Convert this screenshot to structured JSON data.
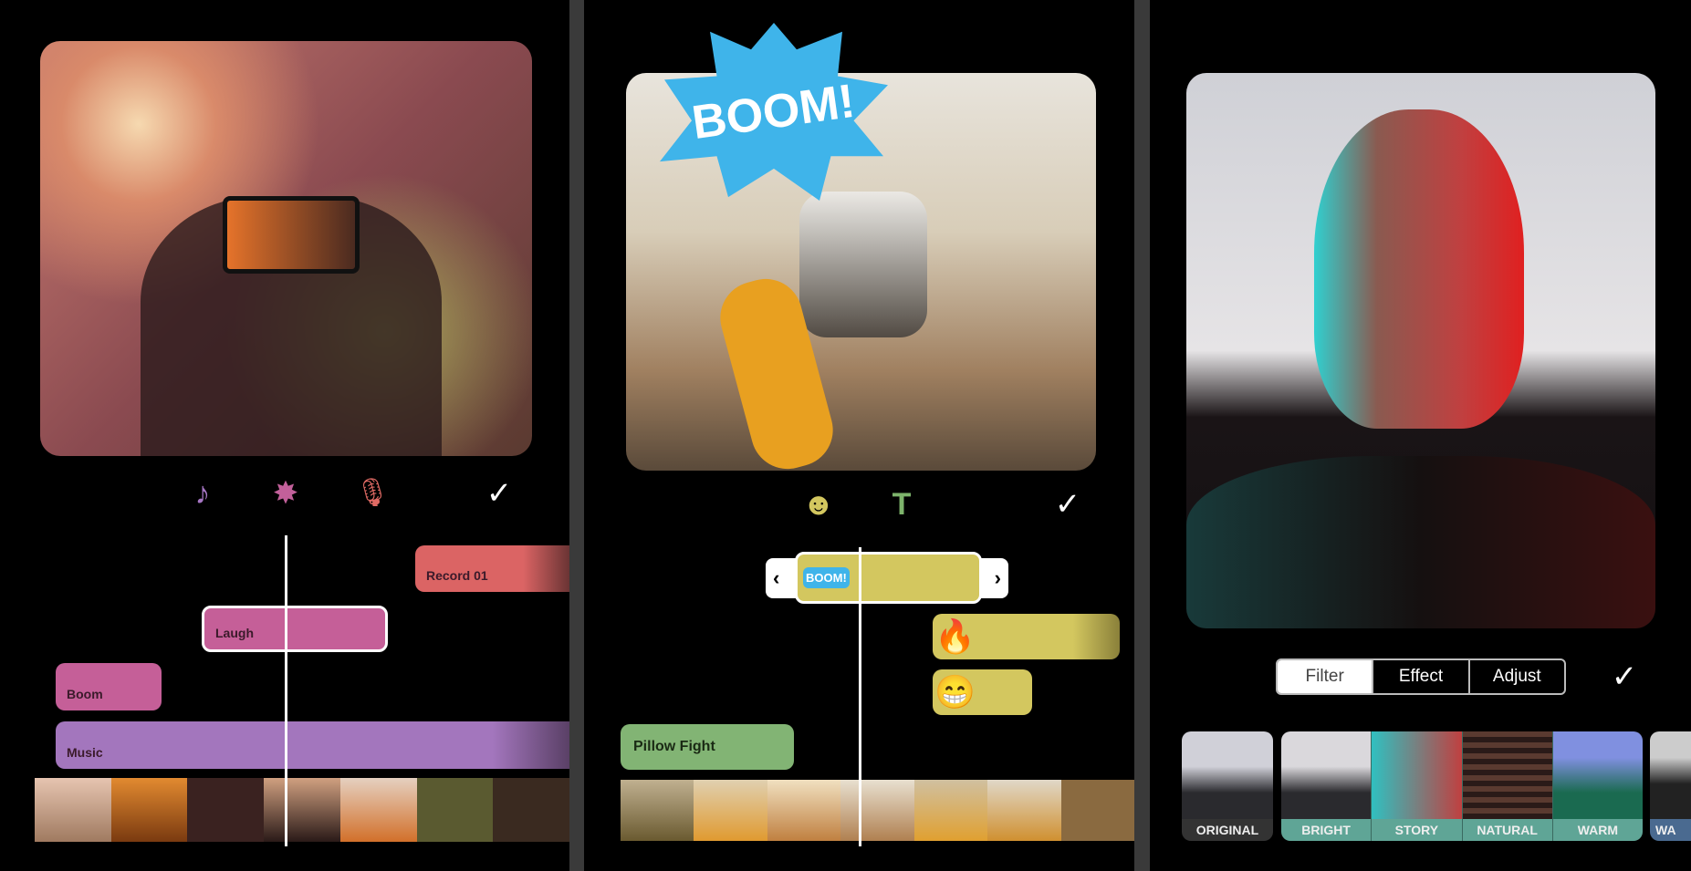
{
  "panel_music": {
    "toolbar": {
      "icons": [
        "music-add-icon",
        "sound-effect-icon",
        "microphone-icon",
        "checkmark-icon"
      ],
      "colors": {
        "music": "#a676c4",
        "effect": "#c2609a",
        "mic": "#e06a64"
      }
    },
    "clips": [
      {
        "label": "Record 01",
        "color": "#db6464"
      },
      {
        "label": "Laugh",
        "color": "#c55f98"
      },
      {
        "label": "Boom",
        "color": "#c55f98"
      },
      {
        "label": "Music",
        "color": "#a376bd"
      }
    ]
  },
  "panel_sticker": {
    "sticker_text": "BOOM!",
    "toolbar": {
      "icons": [
        "sticker-icon",
        "text-icon",
        "checkmark-icon"
      ],
      "colors": {
        "sticker": "#d3c75f",
        "text": "#7db36b"
      }
    },
    "clips": [
      {
        "label": "BOOM!",
        "color": "#d3c75f"
      },
      {
        "label": "🔥",
        "color": "#d3c75f"
      },
      {
        "label": "😁",
        "color": "#d3c75f"
      },
      {
        "label": "Pillow Fight",
        "color": "#82b474"
      }
    ],
    "handle_left": "‹",
    "handle_right": "›"
  },
  "panel_filter": {
    "tabs": [
      "Filter",
      "Effect",
      "Adjust"
    ],
    "active_tab": "Filter",
    "filters": [
      "ORIGINAL",
      "BRIGHT",
      "STORY",
      "NATURAL",
      "WARM",
      "WA"
    ],
    "accent": "#5fa596"
  },
  "check": "✓"
}
